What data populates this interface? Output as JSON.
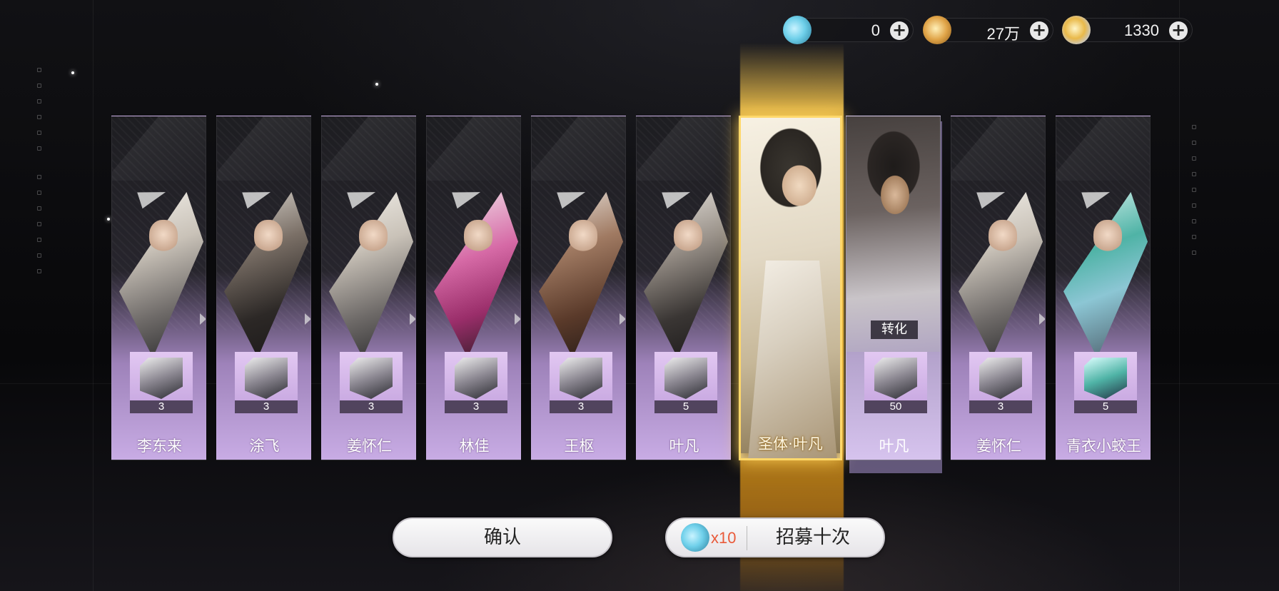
{
  "currencies": [
    {
      "icon": "fish-token-icon",
      "value": "0"
    },
    {
      "icon": "coin-icon",
      "value": "27万"
    },
    {
      "icon": "key-token-icon",
      "value": "1330"
    }
  ],
  "plus_symbol": "+",
  "cards": [
    {
      "name": "李东来",
      "count": "3"
    },
    {
      "name": "涂飞",
      "count": "3"
    },
    {
      "name": "姜怀仁",
      "count": "3"
    },
    {
      "name": "林佳",
      "count": "3"
    },
    {
      "name": "王枢",
      "count": "3"
    },
    {
      "name": "叶凡",
      "count": "5"
    }
  ],
  "featured_card": {
    "name": "圣体·叶凡"
  },
  "converted_card": {
    "label": "转化",
    "name": "叶凡",
    "count": "50"
  },
  "cards_right": [
    {
      "name": "姜怀仁",
      "count": "3"
    },
    {
      "name": "青衣小蛟王",
      "count": "5"
    }
  ],
  "buttons": {
    "confirm": "确认",
    "recruit_cost": "x10",
    "recruit": "招募十次"
  },
  "colors": {
    "card_lavender": "#d2bdea",
    "gold_glow": "#ffd86a",
    "cost_red": "#e95a3a"
  }
}
